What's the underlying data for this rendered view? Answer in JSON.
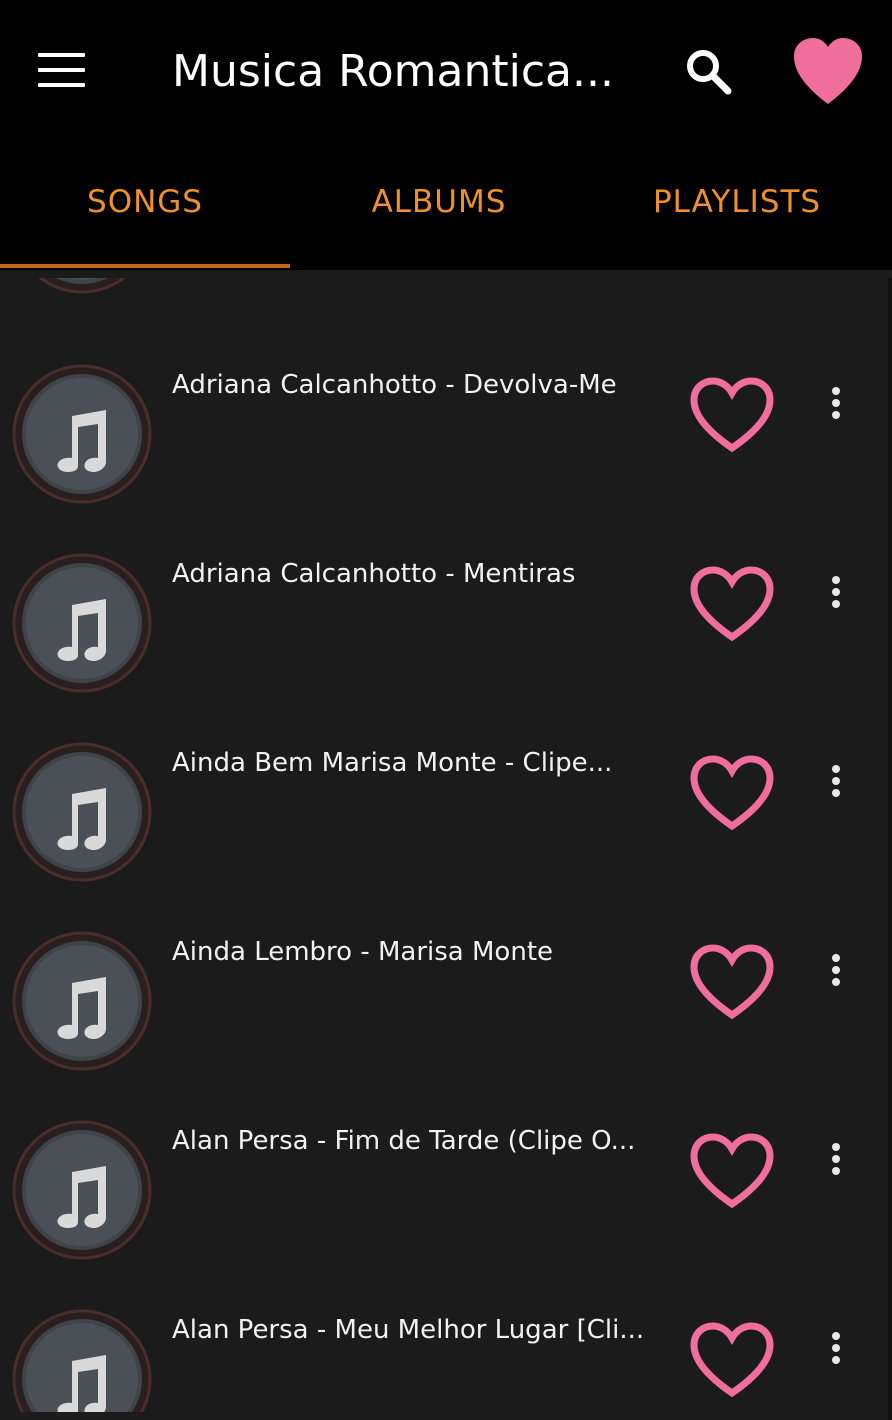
{
  "toolbar": {
    "title": "Musica Romantica...",
    "menu_icon": "hamburger-menu-icon",
    "search_icon": "search-icon",
    "favorite_icon": "heart-filled-icon",
    "heart_color": "#f06e9c"
  },
  "tabs": [
    {
      "label": "SONGS",
      "selected": true
    },
    {
      "label": "ALBUMS",
      "selected": false
    },
    {
      "label": "PLAYLISTS",
      "selected": false
    }
  ],
  "accent_color": "#f0902a",
  "songs": [
    {
      "title": "Adriana Calcanhotto - Devolva-Me"
    },
    {
      "title": "Adriana Calcanhotto - Mentiras"
    },
    {
      "title": "Ainda Bem  Marisa Monte - Clipe..."
    },
    {
      "title": "Ainda Lembro - Marisa Monte"
    },
    {
      "title": "Alan Persa - Fim de Tarde (Clipe O..."
    },
    {
      "title": "Alan Persa - Meu Melhor Lugar [Cli..."
    }
  ]
}
